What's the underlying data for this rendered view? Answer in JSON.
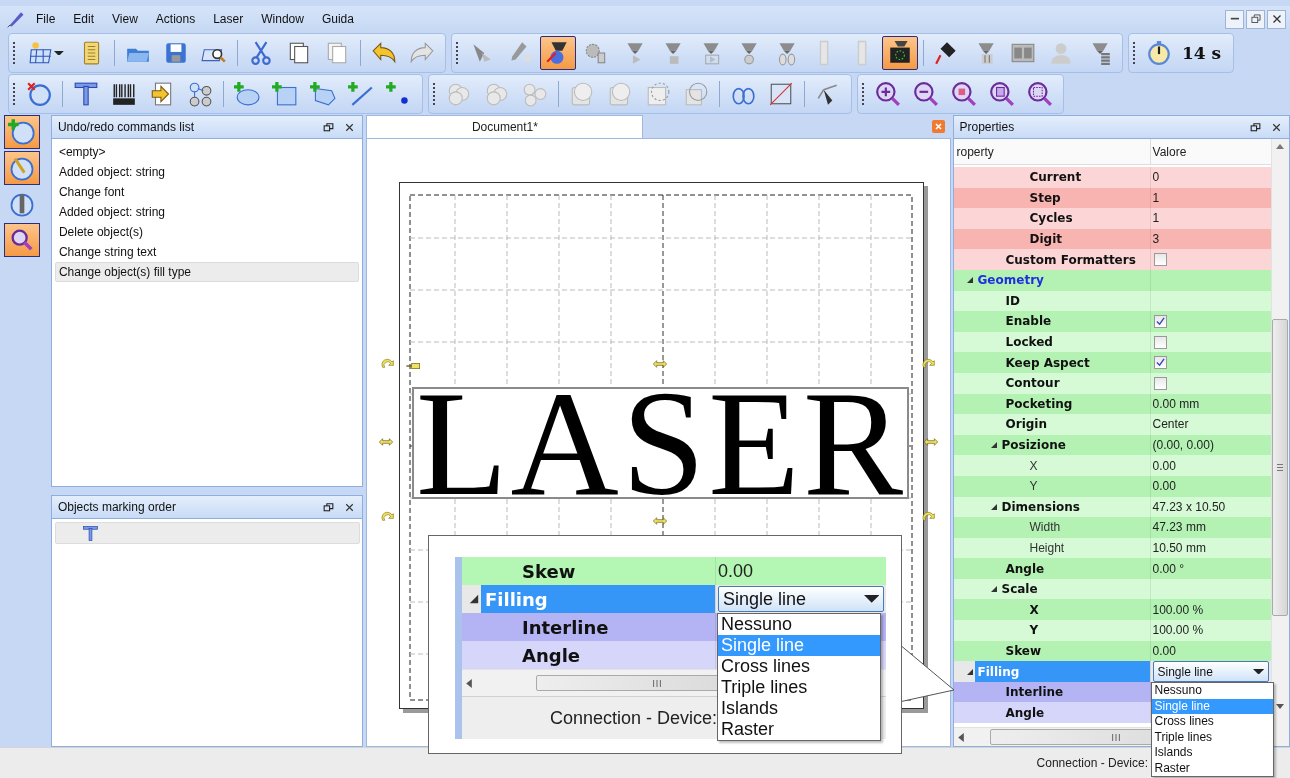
{
  "menu": [
    {
      "label": "File"
    },
    {
      "label": "Edit"
    },
    {
      "label": "View"
    },
    {
      "label": "Actions"
    },
    {
      "label": "Laser"
    },
    {
      "label": "Window"
    },
    {
      "label": "Guida"
    }
  ],
  "toolbar_rows": [
    [
      {
        "sections": [
          [
            {
              "active": false
            },
            {
              "active": false
            }
          ],
          [
            {
              "active": false
            },
            {
              "active": false
            },
            {
              "active": false
            }
          ],
          [
            {
              "active": false
            },
            {
              "active": false
            },
            {
              "active": false
            }
          ],
          [
            {
              "active": false
            },
            {
              "active": false
            }
          ]
        ]
      },
      {
        "sections": [
          [
            {
              "active": false
            },
            {
              "active": false
            },
            {
              "active": true
            },
            {
              "active": false
            },
            {
              "active": false
            },
            {
              "active": false
            },
            {
              "active": false
            },
            {
              "active": false
            },
            {
              "active": false
            },
            {
              "active": false
            },
            {
              "active": false
            },
            {
              "active": true
            }
          ],
          [
            {
              "active": false
            },
            {
              "active": false
            },
            {
              "active": false
            },
            {
              "active": false
            },
            {
              "active": false
            }
          ]
        ]
      },
      {
        "sections": [
          [
            {
              "active": false
            }
          ]
        ],
        "timer": "14 s"
      }
    ],
    [
      {
        "sections": [
          [
            {
              "active": false
            }
          ],
          [
            {
              "active": false
            },
            {
              "active": false
            },
            {
              "active": false
            },
            {
              "active": false
            }
          ],
          [
            {
              "active": false
            },
            {
              "active": false
            },
            {
              "active": false
            },
            {
              "active": false
            },
            {
              "active": false
            }
          ]
        ]
      },
      {
        "sections": [
          [
            {
              "active": false
            },
            {
              "active": false
            },
            {
              "active": false
            }
          ],
          [
            {
              "active": false
            },
            {
              "active": false
            },
            {
              "active": false
            },
            {
              "active": false
            }
          ],
          [
            {
              "active": false
            },
            {
              "active": false
            }
          ],
          [
            {
              "active": false
            }
          ]
        ]
      },
      {
        "sections": [
          [
            {
              "active": false
            },
            {
              "active": false
            },
            {
              "active": false
            },
            {
              "active": false
            },
            {
              "active": false
            }
          ]
        ]
      }
    ]
  ],
  "left_tools": [
    {
      "active": true
    },
    {
      "active": true
    },
    {
      "active": false
    },
    {
      "active": true
    }
  ],
  "undo_panel": {
    "title": "Undo/redo commands list",
    "items": [
      {
        "label": "<empty>",
        "selected": false
      },
      {
        "label": "Added object: string",
        "selected": false
      },
      {
        "label": "Change font",
        "selected": false
      },
      {
        "label": "Added object: string",
        "selected": false
      },
      {
        "label": "Delete object(s)",
        "selected": false
      },
      {
        "label": "Change string text",
        "selected": false
      },
      {
        "label": "Change object(s) fill type",
        "selected": true
      }
    ]
  },
  "order_panel": {
    "title": "Objects marking order",
    "items": [
      {
        "selected": true
      }
    ]
  },
  "document": {
    "tab": "Document1*",
    "text": "LASER"
  },
  "properties": {
    "title": "Properties",
    "columns": [
      "roperty",
      "Valore"
    ],
    "rows": [
      {
        "children": [
          {
            "children": [
              {
                "name": "Current",
                "category": false,
                "bold": true,
                "selected": false,
                "color": "#fcd6d6",
                "kind": "text",
                "value": "0"
              },
              {
                "name": "Step",
                "category": false,
                "bold": true,
                "selected": false,
                "color": "#f8b4b0",
                "kind": "text",
                "value": "1"
              },
              {
                "name": "Cycles",
                "category": false,
                "bold": true,
                "selected": false,
                "color": "#fcd6d6",
                "kind": "text",
                "value": "1"
              },
              {
                "name": "Digit",
                "category": false,
                "bold": true,
                "selected": false,
                "color": "#f8b4b0",
                "kind": "text",
                "value": "3"
              }
            ]
          },
          {
            "name": "Custom Formatters",
            "category": false,
            "bold": true,
            "selected": false,
            "color": "#fcd6d6",
            "kind": "checkbox",
            "checked": false
          }
        ]
      },
      {
        "name": "Geometry",
        "category": true,
        "bold": true,
        "selected": false,
        "color": "#b4f2b4",
        "expanded": true,
        "children": [
          {
            "name": "ID",
            "category": false,
            "bold": true,
            "selected": false,
            "color": "#d6fad6"
          },
          {
            "name": "Enable",
            "category": false,
            "bold": true,
            "selected": false,
            "color": "#b4f2b4",
            "kind": "checkbox",
            "checked": true
          },
          {
            "name": "Locked",
            "category": false,
            "bold": true,
            "selected": false,
            "color": "#d6fad6",
            "kind": "checkbox",
            "checked": false
          },
          {
            "name": "Keep Aspect",
            "category": false,
            "bold": true,
            "selected": false,
            "color": "#b4f2b4",
            "kind": "checkbox",
            "checked": true
          },
          {
            "name": "Contour",
            "category": false,
            "bold": true,
            "selected": false,
            "color": "#d6fad6",
            "kind": "checkbox",
            "checked": false
          },
          {
            "name": "Pocketing",
            "category": false,
            "bold": true,
            "selected": false,
            "color": "#b4f2b4",
            "kind": "text",
            "value": "0.00 mm"
          },
          {
            "name": "Origin",
            "category": false,
            "bold": true,
            "selected": false,
            "color": "#d6fad6",
            "kind": "text",
            "value": "Center"
          },
          {
            "name": "Posizione",
            "category": false,
            "bold": true,
            "selected": false,
            "color": "#b4f2b4",
            "kind": "text",
            "value": "(0.00, 0.00)",
            "expanded": true,
            "children": [
              {
                "name": "X",
                "category": false,
                "bold": false,
                "selected": false,
                "color": "#d6fad6",
                "kind": "text",
                "value": "0.00"
              },
              {
                "name": "Y",
                "category": false,
                "bold": false,
                "selected": false,
                "color": "#b4f2b4",
                "kind": "text",
                "value": "0.00"
              }
            ]
          },
          {
            "name": "Dimensions",
            "category": false,
            "bold": true,
            "selected": false,
            "color": "#d6fad6",
            "kind": "text",
            "value": "47.23 x 10.50",
            "expanded": true,
            "children": [
              {
                "name": "Width",
                "category": false,
                "bold": false,
                "selected": false,
                "color": "#b4f2b4",
                "kind": "text",
                "value": "47.23 mm"
              },
              {
                "name": "Height",
                "category": false,
                "bold": false,
                "selected": false,
                "color": "#d6fad6",
                "kind": "text",
                "value": "10.50 mm"
              }
            ]
          },
          {
            "name": "Angle",
            "category": false,
            "bold": true,
            "selected": false,
            "color": "#b4f2b4",
            "kind": "text",
            "value": "0.00 °"
          },
          {
            "name": "Scale",
            "category": false,
            "bold": true,
            "selected": false,
            "color": "#d6fad6",
            "expanded": true,
            "children": [
              {
                "name": "X",
                "category": false,
                "bold": true,
                "selected": false,
                "color": "#b4f2b4",
                "kind": "text",
                "value": "100.00 %"
              },
              {
                "name": "Y",
                "category": false,
                "bold": true,
                "selected": false,
                "color": "#d6fad6",
                "kind": "text",
                "value": "100.00 %"
              }
            ]
          },
          {
            "name": "Skew",
            "category": false,
            "bold": true,
            "selected": false,
            "color": "#b4f2b4",
            "kind": "text",
            "value": "0.00"
          }
        ]
      },
      {
        "name": "Filling",
        "category": true,
        "bold": true,
        "selected": true,
        "expanded": true,
        "kind": "dropdown",
        "value": "Single line",
        "children": [
          {
            "name": "Interline",
            "category": false,
            "bold": true,
            "selected": false,
            "color": "#b4b4f4"
          },
          {
            "name": "Angle",
            "category": false,
            "bold": true,
            "selected": false,
            "color": "#d6d6fa"
          }
        ]
      }
    ],
    "dropdown_options": [
      {
        "label": "Nessuno",
        "selected": false
      },
      {
        "label": "Single line",
        "selected": true
      },
      {
        "label": "Cross lines",
        "selected": false
      },
      {
        "label": "Triple lines",
        "selected": false
      },
      {
        "label": "Islands",
        "selected": false
      },
      {
        "label": "Raster",
        "selected": false
      }
    ]
  },
  "magnifier": {
    "rows": [
      {
        "children": [
          {
            "name": "Skew",
            "category": false,
            "bold": true,
            "selected": false,
            "color": "#b4f6b4",
            "kind": "text",
            "value": "0.00"
          }
        ]
      },
      {
        "name": "Filling",
        "category": true,
        "bold": true,
        "selected": true,
        "expanded": true,
        "kind": "dropdown",
        "value": "Single line",
        "children": [
          {
            "name": "Interline",
            "category": false,
            "bold": true,
            "selected": false,
            "color": "#b4b4f4"
          },
          {
            "name": "Angle",
            "category": false,
            "bold": true,
            "selected": false,
            "color": "#d6d6fa"
          }
        ]
      }
    ],
    "dropdown_options": [
      {
        "label": "Nessuno",
        "selected": false
      },
      {
        "label": "Single line",
        "selected": true
      },
      {
        "label": "Cross lines",
        "selected": false
      },
      {
        "label": "Triple lines",
        "selected": false
      },
      {
        "label": "Islands",
        "selected": false
      },
      {
        "label": "Raster",
        "selected": false
      }
    ],
    "status": "Connection - Device:"
  },
  "status_bar": {
    "text": "Connection - Device:"
  }
}
